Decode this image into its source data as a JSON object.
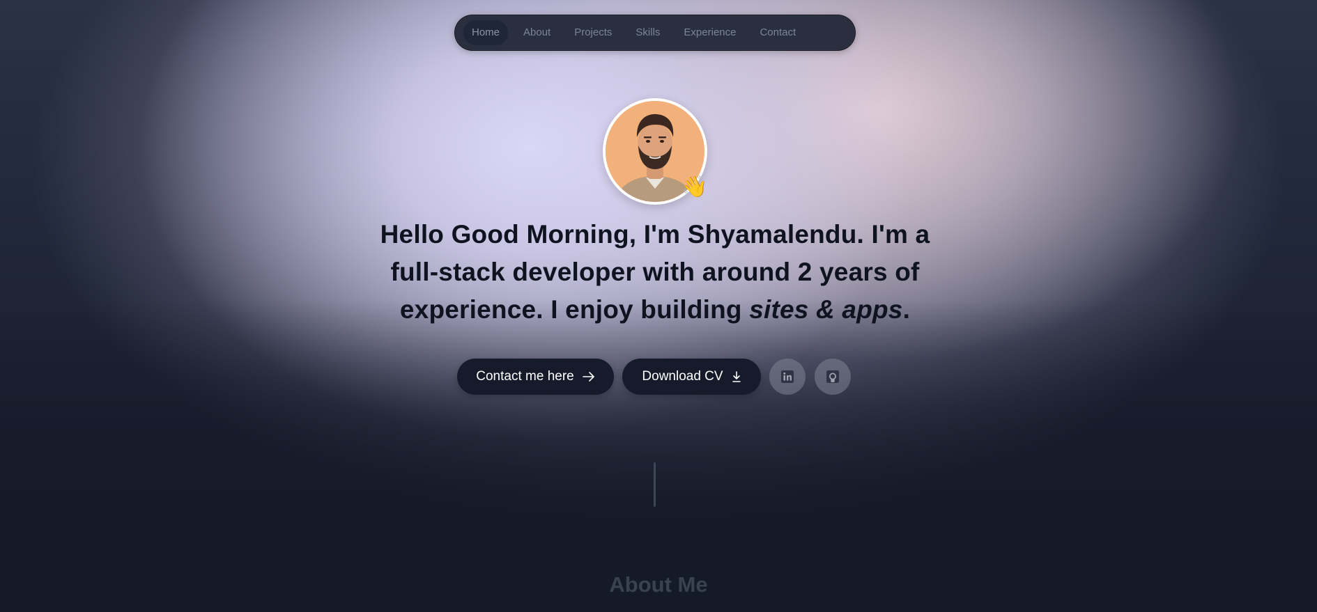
{
  "nav": {
    "items": [
      {
        "label": "Home",
        "active": true
      },
      {
        "label": "About",
        "active": false
      },
      {
        "label": "Projects",
        "active": false
      },
      {
        "label": "Skills",
        "active": false
      },
      {
        "label": "Experience",
        "active": false
      },
      {
        "label": "Contact",
        "active": false
      }
    ]
  },
  "hero": {
    "avatar_icon": "profile-photo",
    "wave_emoji": "👋",
    "headline": {
      "greeting": "Hello Good Morning, I'm Shyamalendu.",
      "part1": " I'm a ",
      "role": "full-stack developer",
      "part2": " with ",
      "years": "around 2 years",
      "part3": " of experience. I enjoy building ",
      "emph": "sites & apps",
      "part4": "."
    },
    "buttons": {
      "contact_label": "Contact me here",
      "cv_label": "Download CV"
    },
    "social": {
      "linkedin_icon": "linkedin-icon",
      "github_icon": "github-icon"
    }
  },
  "about": {
    "title": "About Me"
  },
  "colors": {
    "button_bg": "#151b2b",
    "page_bg": "#141a28",
    "headline": "#0f1320"
  }
}
